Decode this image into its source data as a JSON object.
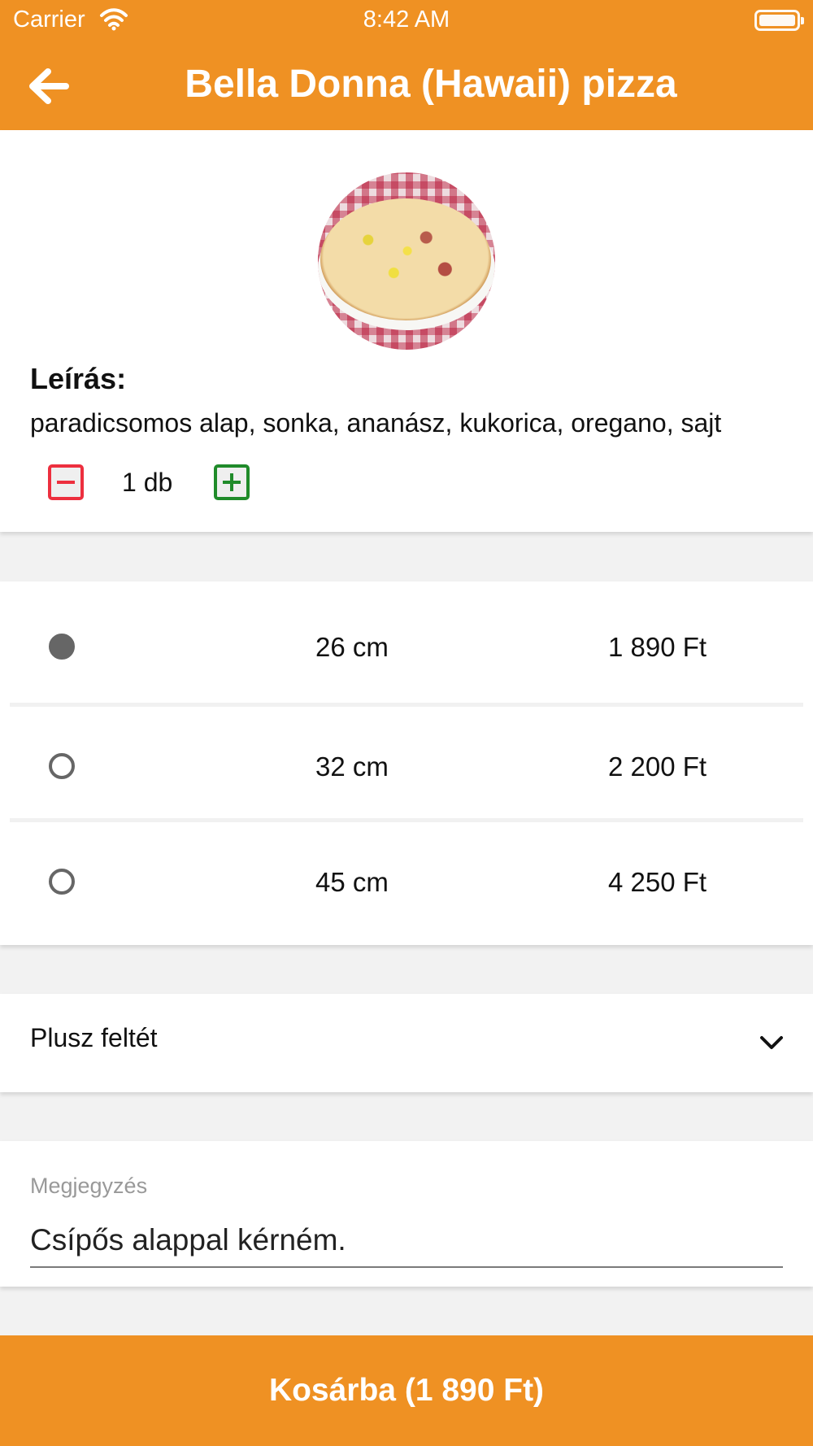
{
  "status_bar": {
    "carrier": "Carrier",
    "time": "8:42 AM",
    "wifi_icon": "wifi-icon",
    "battery_icon": "battery-icon"
  },
  "header": {
    "title": "Bella Donna (Hawaii) pizza",
    "back_icon": "arrow-left-icon",
    "background": "#ef9123"
  },
  "product": {
    "image_icon": "pizza-image",
    "description_label": "Leírás:",
    "description": "paradicsomos alap, sonka, ananász, kukorica, oregano, sajt",
    "quantity": "1 db",
    "decrease_icon": "minus-square-icon",
    "increase_icon": "plus-square-icon",
    "decrease_color": "#ed2f3e",
    "increase_color": "#208b2a"
  },
  "sizes": [
    {
      "size": "26 cm",
      "price": "1 890 Ft",
      "selected": true
    },
    {
      "size": "32 cm",
      "price": "2 200 Ft",
      "selected": false
    },
    {
      "size": "45 cm",
      "price": "4 250 Ft",
      "selected": false
    }
  ],
  "extras": {
    "label": "Plusz feltét",
    "icon": "chevron-down-icon"
  },
  "note": {
    "label": "Megjegyzés",
    "value": "Csípős alappal kérném."
  },
  "cart_button": {
    "label": "Kosárba (1 890 Ft)",
    "background": "#ef9123"
  }
}
